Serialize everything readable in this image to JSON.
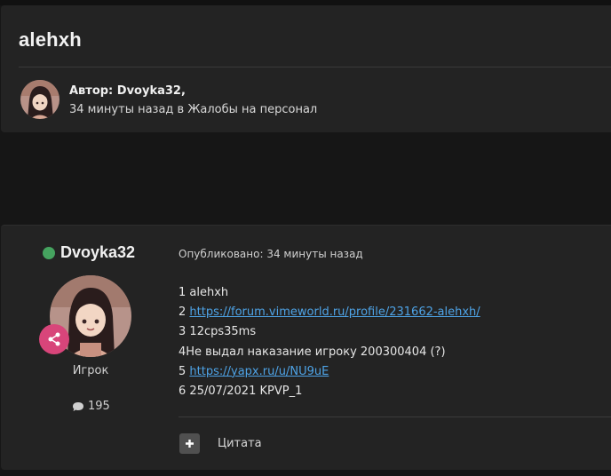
{
  "topic": {
    "title": "alehxh"
  },
  "meta": {
    "author_label": "Автор: Dvoyka32,",
    "time_and_section": "34 минуты назад в Жалобы на персонал"
  },
  "post": {
    "username": "Dvoyka32",
    "online": true,
    "role": "Игрок",
    "reputation": "195",
    "published": "Опубликовано: 34 минуты назад",
    "lines": [
      {
        "num": "1",
        "text": "alehxh"
      },
      {
        "num": "2",
        "link": "https://forum.vimeworld.ru/profile/231662-alehxh/"
      },
      {
        "num": "3",
        "text": "12cps35ms"
      },
      {
        "num": "4",
        "text": "Не выдал наказание игроку 200300404 (?)"
      },
      {
        "num": "5",
        "link": "https://yapx.ru/u/NU9uE"
      },
      {
        "num": "6",
        "text": "25/07/2021 KPVP_1"
      }
    ],
    "actions": {
      "quote_label": "Цитата"
    }
  },
  "colors": {
    "online": "#45a35f",
    "role_badge": "#d8457a",
    "link": "#4ea3e6",
    "card_bg": "#232323",
    "page_bg": "#161616"
  },
  "icons": {
    "online": "online-status-dot",
    "role": "share-nodes-icon",
    "reputation": "speech-bubble-icon",
    "multiquote": "plus-icon"
  }
}
